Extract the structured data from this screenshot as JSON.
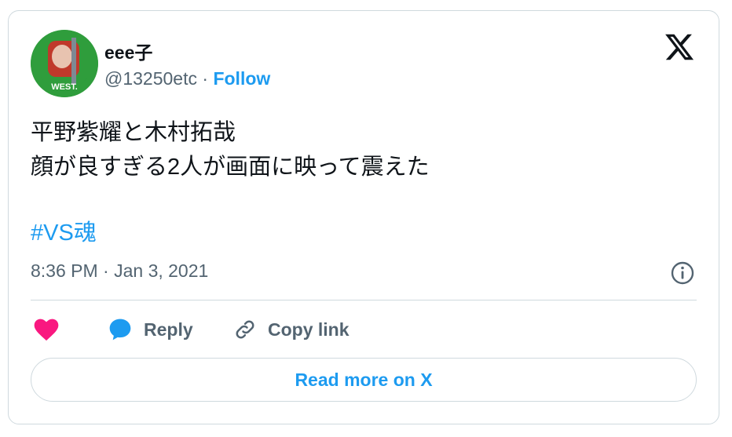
{
  "author": {
    "display_name": "eee子",
    "handle": "@13250etc",
    "separator": " · ",
    "follow_label": "Follow",
    "avatar_text": "WEST."
  },
  "tweet": {
    "lines": [
      "平野紫耀と木村拓哉",
      "顔が良すぎる2人が画面に映って震えた"
    ],
    "hashtag": "#VS魂",
    "timestamp": "8:36 PM · Jan 3, 2021"
  },
  "actions": {
    "reply_label": "Reply",
    "copy_link_label": "Copy link"
  },
  "read_more_label": "Read more on X",
  "colors": {
    "accent": "#1d9bf0",
    "like": "#f91880",
    "text": "#0f1419",
    "secondary": "#536471",
    "border": "#cfd9de",
    "avatar_bg": "#2f9d3c"
  }
}
